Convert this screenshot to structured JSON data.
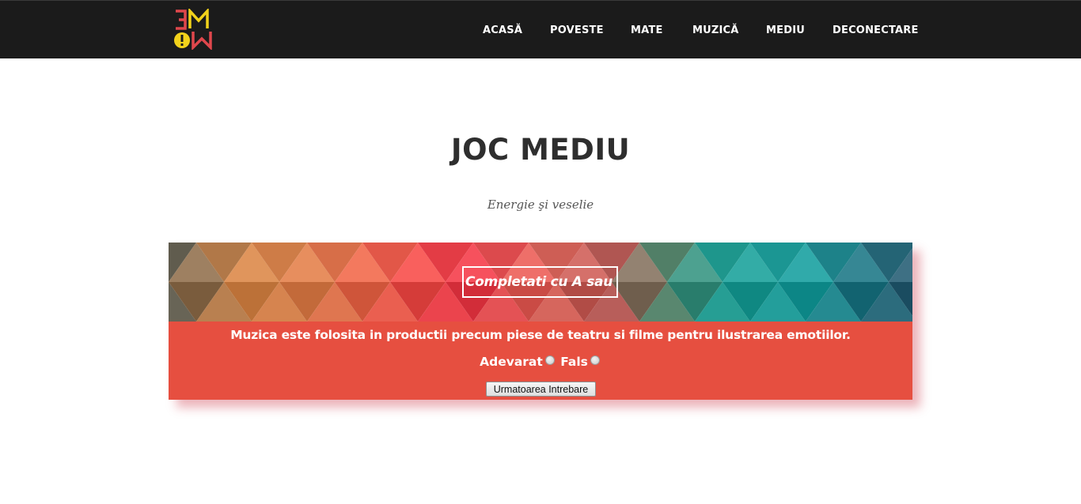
{
  "header": {
    "logo": {
      "icon": "3mow-logo",
      "colors": {
        "red": "#e0474c",
        "yellow": "#f2d21b"
      }
    },
    "nav": [
      {
        "label": "ACASĂ"
      },
      {
        "label": "POVESTE"
      },
      {
        "label": "MATE"
      },
      {
        "label": "MUZICĂ"
      },
      {
        "label": "MEDIU"
      },
      {
        "label": "DECONECTARE"
      }
    ]
  },
  "main": {
    "title": "JOC MEDIU",
    "subtitle": "Energie şi veselie"
  },
  "quiz": {
    "banner_text": "Completati cu A sau F",
    "question": "Muzica este folosita in productii precum piese de teatru si filme pentru ilustrarea emotiilor.",
    "options": [
      {
        "label": "Adevarat",
        "selected": false
      },
      {
        "label": "Fals",
        "selected": false
      }
    ],
    "next_button": "Urmatoarea Intrebare",
    "colors": {
      "body": "#e64f40"
    }
  }
}
